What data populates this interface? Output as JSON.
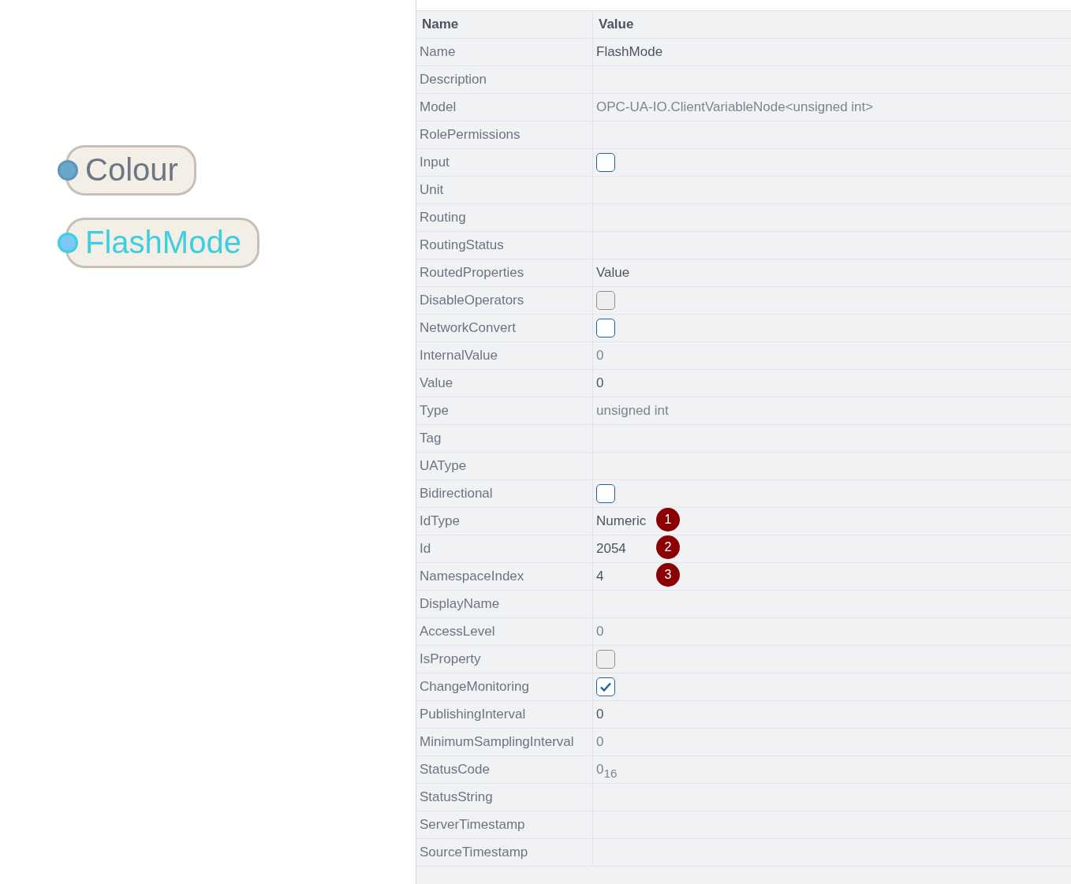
{
  "nodes": [
    {
      "label": "Colour",
      "selected": false
    },
    {
      "label": "FlashMode",
      "selected": true
    }
  ],
  "properties": {
    "columns": [
      "Name",
      "Value"
    ],
    "rows": [
      {
        "name": "Name",
        "kind": "text",
        "value": "FlashMode",
        "readonly": false
      },
      {
        "name": "Description",
        "kind": "empty"
      },
      {
        "name": "Model",
        "kind": "text",
        "value": "OPC-UA-IO.ClientVariableNode<unsigned int>",
        "readonly": true
      },
      {
        "name": "RolePermissions",
        "kind": "empty"
      },
      {
        "name": "Input",
        "kind": "checkbox",
        "checked": false,
        "disabled": false
      },
      {
        "name": "Unit",
        "kind": "empty"
      },
      {
        "name": "Routing",
        "kind": "empty"
      },
      {
        "name": "RoutingStatus",
        "kind": "empty"
      },
      {
        "name": "RoutedProperties",
        "kind": "text",
        "value": "Value",
        "readonly": false
      },
      {
        "name": "DisableOperators",
        "kind": "checkbox",
        "checked": false,
        "disabled": true
      },
      {
        "name": "NetworkConvert",
        "kind": "checkbox",
        "checked": false,
        "disabled": false
      },
      {
        "name": "InternalValue",
        "kind": "text",
        "value": "0",
        "readonly": true
      },
      {
        "name": "Value",
        "kind": "text",
        "value": "0",
        "readonly": false
      },
      {
        "name": "Type",
        "kind": "text",
        "value": "unsigned int",
        "readonly": true
      },
      {
        "name": "Tag",
        "kind": "empty"
      },
      {
        "name": "UAType",
        "kind": "empty"
      },
      {
        "name": "Bidirectional",
        "kind": "checkbox",
        "checked": false,
        "disabled": false
      },
      {
        "name": "IdType",
        "kind": "text",
        "value": "Numeric",
        "readonly": false,
        "badge": "1"
      },
      {
        "name": "Id",
        "kind": "text",
        "value": "2054",
        "readonly": false,
        "badge": "2"
      },
      {
        "name": "NamespaceIndex",
        "kind": "text",
        "value": "4",
        "readonly": false,
        "badge": "3"
      },
      {
        "name": "DisplayName",
        "kind": "empty"
      },
      {
        "name": "AccessLevel",
        "kind": "text",
        "value": "0",
        "readonly": true
      },
      {
        "name": "IsProperty",
        "kind": "checkbox",
        "checked": false,
        "disabled": true
      },
      {
        "name": "ChangeMonitoring",
        "kind": "checkbox",
        "checked": true,
        "disabled": false
      },
      {
        "name": "PublishingInterval",
        "kind": "text",
        "value": "0",
        "readonly": false
      },
      {
        "name": "MinimumSamplingInterval",
        "kind": "text",
        "value": "0",
        "readonly": true
      },
      {
        "name": "StatusCode",
        "kind": "text",
        "value": "0$_{16}$",
        "readonly": true
      },
      {
        "name": "StatusString",
        "kind": "empty"
      },
      {
        "name": "ServerTimestamp",
        "kind": "empty"
      },
      {
        "name": "SourceTimestamp",
        "kind": "empty"
      }
    ]
  }
}
